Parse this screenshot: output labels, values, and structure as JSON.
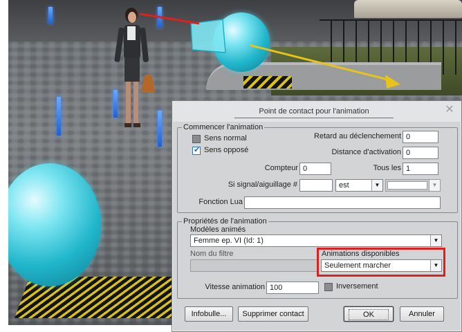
{
  "dialog": {
    "title": "Point de contact pour l'animation",
    "close_symbol": "✕"
  },
  "start_group": {
    "legend": "Commencer l'animation",
    "normal_direction": {
      "label": "Sens normal",
      "checked": false
    },
    "opposite_direction": {
      "label": "Sens opposé",
      "checked": true
    },
    "trigger_delay": {
      "label": "Retard au déclenchement",
      "value": "0"
    },
    "activation_distance": {
      "label": "Distance d'activation",
      "value": "0"
    },
    "counter": {
      "label": "Compteur",
      "value": "0"
    },
    "every": {
      "label": "Tous les",
      "value": "1"
    },
    "signal_switch": {
      "label": "Si signal/aiguillage #",
      "value": "",
      "state": "est",
      "state_value": ""
    },
    "lua_function": {
      "label": "Fonction Lua",
      "value": ""
    }
  },
  "props_group": {
    "legend": "Propriétés de l'animation",
    "models": {
      "label": "Modèles animés",
      "value": "Femme ep. VI (Id: 1)"
    },
    "filter_name": {
      "label": "Nom du filtre",
      "value": ""
    },
    "available_animations": {
      "label": "Animations disponibles",
      "value": "Seulement marcher"
    },
    "animation_speed": {
      "label": "Vitesse animation",
      "value": "100"
    },
    "reverse": {
      "label": "Inversement",
      "checked": false
    }
  },
  "buttons": {
    "tooltip": "Infobulle...",
    "delete_contact": "Supprimer contact",
    "ok": "OK",
    "cancel": "Annuler"
  },
  "colors": {
    "highlight": "#e01e1e",
    "sphere": "#21b6cc",
    "marker": "#1f5fd6",
    "arrow": "#e8c31a"
  }
}
